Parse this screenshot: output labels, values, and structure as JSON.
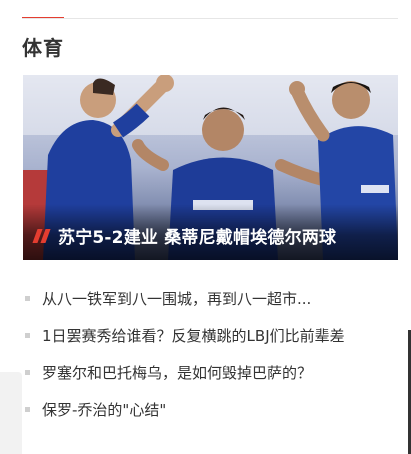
{
  "section": {
    "title": "体育"
  },
  "hero": {
    "caption": "苏宁5-2建业 桑蒂尼戴帽埃德尔两球",
    "accent_color": "#e43d30"
  },
  "news": {
    "items": [
      {
        "text": "从八一铁军到八一围城，再到八一超市..."
      },
      {
        "text": "1日罢赛秀给谁看？反复横跳的LBJ们比前辈差"
      },
      {
        "text": "罗塞尔和巴托梅乌，是如何毁掉巴萨的？"
      },
      {
        "text": "保罗-乔治的\"心结\""
      }
    ]
  }
}
